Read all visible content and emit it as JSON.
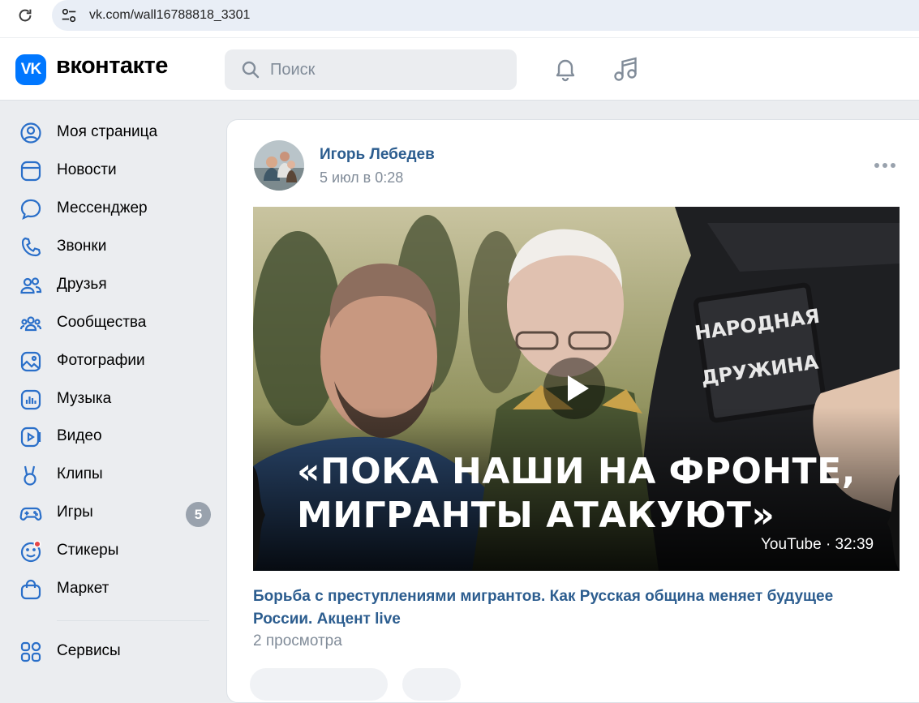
{
  "browser": {
    "url": "vk.com/wall16788818_3301"
  },
  "header": {
    "logo_mark": "VK",
    "logo_text": "вконтакте",
    "search_placeholder": "Поиск",
    "icons": [
      "bell-icon",
      "music-note-icon"
    ]
  },
  "sidebar": {
    "items": [
      {
        "label": "Моя страница",
        "icon": "user-circle-icon"
      },
      {
        "label": "Новости",
        "icon": "news-icon"
      },
      {
        "label": "Мессенджер",
        "icon": "message-icon"
      },
      {
        "label": "Звонки",
        "icon": "phone-icon"
      },
      {
        "label": "Друзья",
        "icon": "friends-icon"
      },
      {
        "label": "Сообщества",
        "icon": "communities-icon"
      },
      {
        "label": "Фотографии",
        "icon": "photo-icon"
      },
      {
        "label": "Музыка",
        "icon": "music-icon"
      },
      {
        "label": "Видео",
        "icon": "video-icon"
      },
      {
        "label": "Клипы",
        "icon": "clips-icon"
      },
      {
        "label": "Игры",
        "icon": "gamepad-icon",
        "badge": "5"
      },
      {
        "label": "Стикеры",
        "icon": "sticker-icon"
      },
      {
        "label": "Маркет",
        "icon": "market-bag-icon"
      },
      {
        "label": "Сервисы",
        "icon": "services-grid-icon"
      }
    ]
  },
  "post": {
    "author": "Игорь Лебедев",
    "date": "5 июл в 0:28",
    "video": {
      "headline_line1": "«ПОКА НАШИ НА ФРОНТЕ,",
      "headline_line2": "МИГРАНТЫ АТАКУЮТ»",
      "patch_line1": "НАРОДНАЯ",
      "patch_line2": "ДРУЖИНА",
      "source_duration": "YouTube · 32:39"
    },
    "title": "Борьба с преступлениями мигрантов. Как Русская община меняет будущее России. Акцент live",
    "views": "2 просмотра"
  },
  "colors": {
    "vk_blue": "#0077ff",
    "link": "#2c5d8f",
    "secondary_text": "#818c99",
    "badge_grey": "#99a2ad",
    "page_bg": "#ebedf0"
  }
}
